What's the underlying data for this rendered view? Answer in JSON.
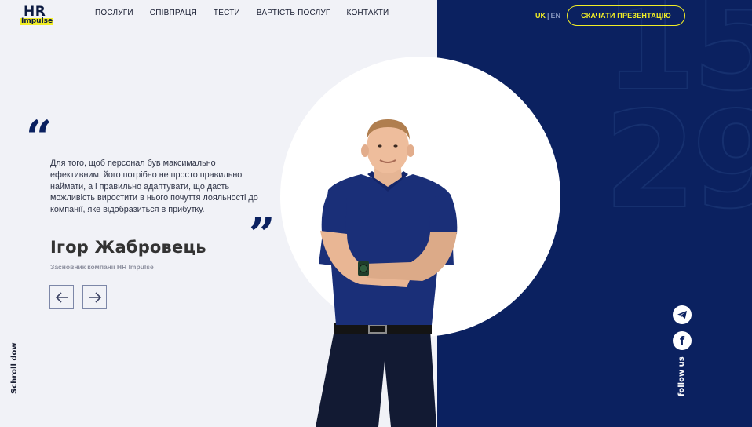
{
  "brand": {
    "logo_top": "HR",
    "logo_bottom": "Impulse"
  },
  "nav": {
    "items": [
      "ПОСЛУГИ",
      "СПІВПРАЦЯ",
      "ТЕСТИ",
      "ВАРТІСТЬ ПОСЛУГ",
      "КОНТАКТИ"
    ]
  },
  "lang": {
    "active": "UK",
    "separator": "|",
    "other": "EN"
  },
  "cta": {
    "label": "СКАЧАТИ ПРЕЗЕНТАЦІЮ"
  },
  "quote": {
    "open_mark": "“",
    "close_mark": "”",
    "text": "Для того, щоб персонал був максимально ефективним, його потрібно не просто правильно наймати, а і правильно адаптувати, що дасть можливість виростити в нього почуття лояльності до компанії, яке відобразиться в прибутку.",
    "author": "Ігор Жабровець",
    "role": "Засновник компанії HR Impulse"
  },
  "slider": {
    "prev_icon": "arrow-left-icon",
    "next_icon": "arrow-right-icon"
  },
  "scroll_hint": "Schroll dow",
  "social": {
    "telegram_icon": "telegram-icon",
    "facebook_icon": "facebook-icon",
    "facebook_glyph": "f",
    "follow_label": "follow us"
  },
  "colors": {
    "navy": "#0b2160",
    "accent_yellow": "#f2ee26",
    "light_bg": "#f1f2f7"
  }
}
